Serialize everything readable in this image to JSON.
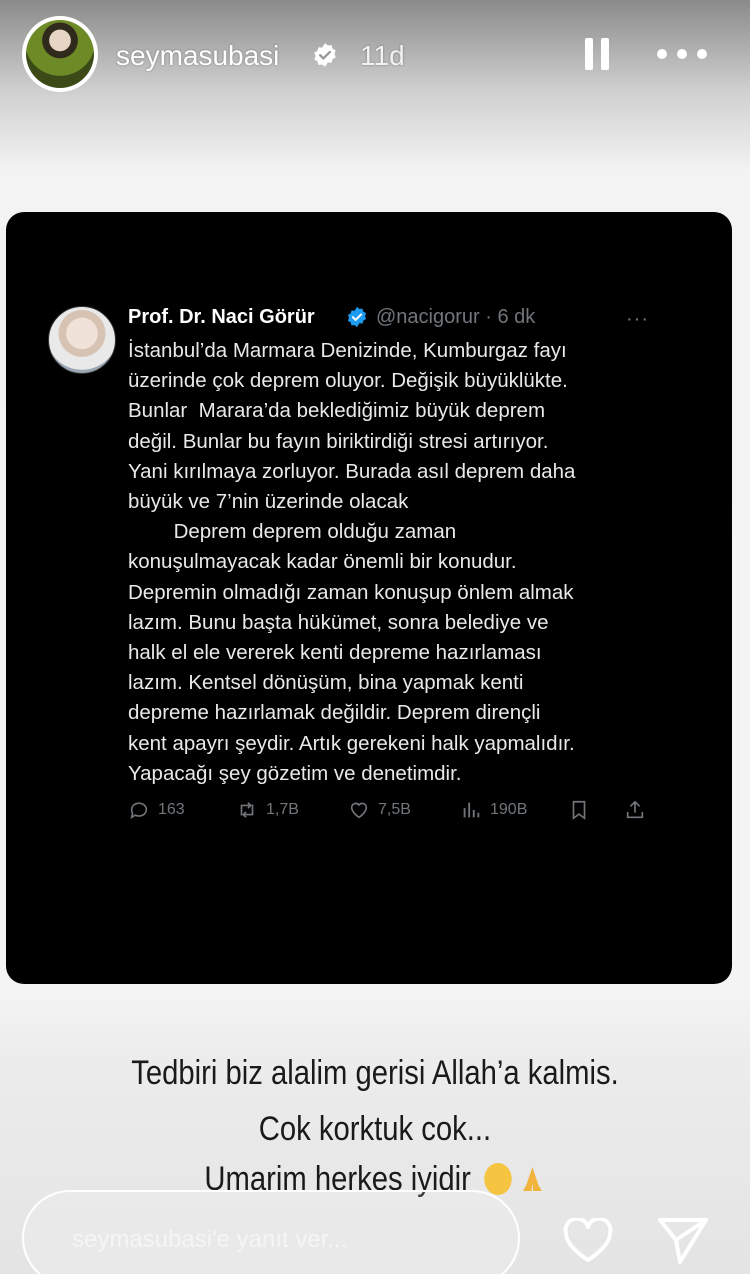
{
  "story": {
    "username": "seymasubasi",
    "time_ago": "11d"
  },
  "tweet": {
    "name": "Prof. Dr. Naci Görür",
    "handle": "@nacigorur · 6 dk",
    "more": "···",
    "lines": [
      "İstanbul’da Marmara Denizinde, Kumburgaz fayı",
      "üzerinde çok deprem oluyor. Değişik büyüklükte.",
      "Bunlar  Marara’da beklediğimiz büyük deprem",
      "değil. Bunlar bu fayın biriktirdiği stresi artırıyor.",
      "Yani kırılmaya zorluyor. Burada asıl deprem daha",
      "büyük ve 7’nin üzerinde olacak",
      "        Deprem deprem olduğu zaman",
      "konuşulmayacak kadar önemli bir konudur.",
      "Depremin olmadığı zaman konuşup önlem almak",
      "lazım. Bunu başta hükümet, sonra belediye ve",
      "halk el ele vererek kenti depreme hazırlaması",
      "lazım. Kentsel dönüşüm, bina yapmak kenti",
      "depreme hazırlamak değildir. Deprem dirençli",
      "kent apayrı şeydir. Artık gerekeni halk yapmalıdır.",
      "Yapacağı şey gözetim ve denetimdir."
    ],
    "stats": {
      "replies": "163",
      "retweets": "1,7B",
      "likes": "7,5B",
      "views": "190B"
    }
  },
  "caption": {
    "line1": "Tedbiri biz alalim gerisi Allah’a kalmis.",
    "line2": "Cok korktuk cok...",
    "line3": "Umarim herkes iyidir"
  },
  "reply": {
    "placeholder": "seymasubasi'e yanıt ver..."
  },
  "icons": [
    "verified-icon",
    "pause-icon",
    "more-icon",
    "reply-icon",
    "retweet-icon",
    "like-icon",
    "views-icon",
    "bookmark-icon",
    "share-icon",
    "heart-icon",
    "send-icon"
  ],
  "colors": {
    "tweet_bg": "#000000",
    "tweet_text": "#e7e9ea",
    "tweet_muted": "#71767b",
    "verified_blue": "#1d9bf0"
  }
}
